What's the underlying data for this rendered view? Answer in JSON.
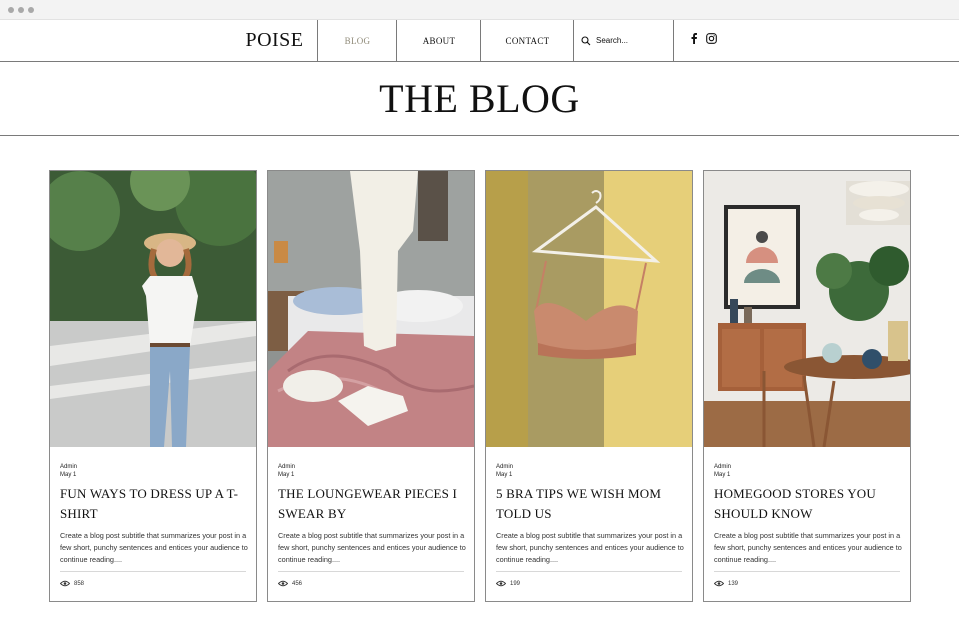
{
  "nav": {
    "logo": "POISE",
    "items": [
      {
        "label": "BLOG",
        "active": true
      },
      {
        "label": "ABOUT",
        "active": false
      },
      {
        "label": "CONTACT",
        "active": false
      }
    ],
    "search_placeholder": "Search...",
    "social_icons": [
      "facebook-icon",
      "instagram-icon"
    ]
  },
  "hero": {
    "title": "THE BLOG"
  },
  "colors": {
    "active_nav": "#8f8a78",
    "border": "#7a7a7a"
  },
  "posts": [
    {
      "author": "Admin",
      "date": "May 1",
      "title": "FUN WAYS TO DRESS UP A T-SHIRT",
      "excerpt": "Create a blog post subtitle that summarizes your post in a few short, punchy sentences and entices your audience to continue reading....",
      "views": "858",
      "image": "woman-in-hat-white-tshirt-photo"
    },
    {
      "author": "Admin",
      "date": "May 1",
      "title": "THE LOUNGEWEAR PIECES I SWEAR BY",
      "excerpt": "Create a blog post subtitle that summarizes your post in a few short, punchy sentences and entices your audience to continue reading....",
      "views": "456",
      "image": "loungewear-on-bed-photo"
    },
    {
      "author": "Admin",
      "date": "May 1",
      "title": "5 BRA TIPS WE WISH MOM TOLD US",
      "excerpt": "Create a blog post subtitle that summarizes your post in a few short, punchy sentences and entices your audience to continue reading....",
      "views": "199",
      "image": "bralette-on-hanger-photo"
    },
    {
      "author": "Admin",
      "date": "May 1",
      "title": "HOMEGOOD STORES YOU SHOULD KNOW",
      "excerpt": "Create a blog post subtitle that summarizes your post in a few short, punchy sentences and entices your audience to continue reading....",
      "views": "139",
      "image": "dining-room-interior-photo"
    }
  ]
}
